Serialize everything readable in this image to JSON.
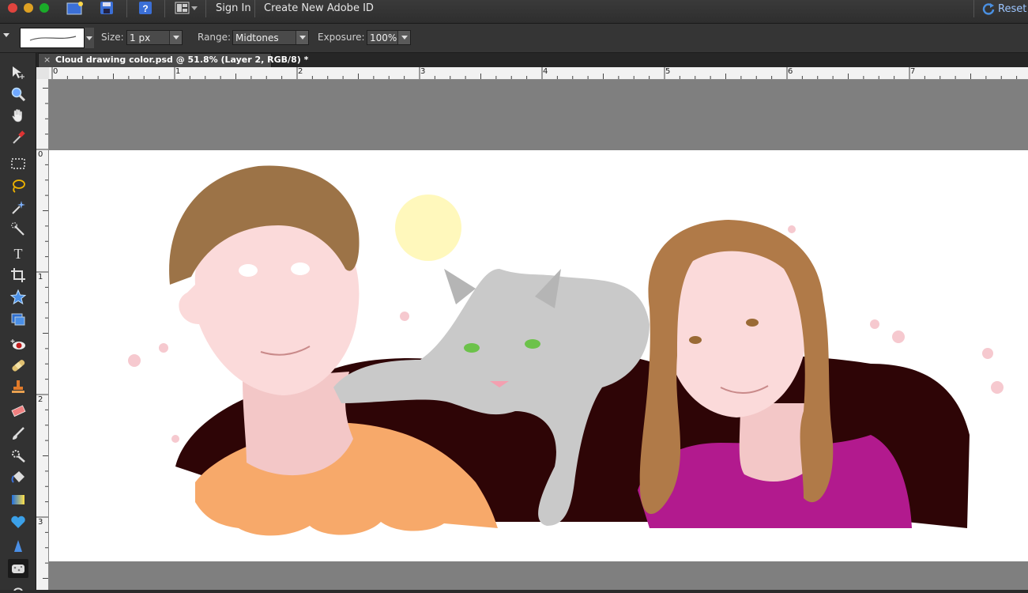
{
  "menubar": {
    "sign_in": "Sign In",
    "create_id": "Create New Adobe ID",
    "reset": "Reset"
  },
  "options": {
    "size_label": "Size:",
    "size_value": "1 px",
    "range_label": "Range:",
    "range_value": "Midtones",
    "exposure_label": "Exposure:",
    "exposure_value": "100%"
  },
  "document": {
    "tab_title": "Cloud drawing color.psd @ 51.8% (Layer 2, RGB/8) *",
    "close": "×"
  },
  "rulers": {
    "top": [
      "0",
      "1",
      "2",
      "3",
      "4",
      "5",
      "6",
      "7"
    ],
    "left": [
      "0",
      "1",
      "2",
      "3"
    ]
  },
  "tools": [
    "move-icon",
    "zoom-icon",
    "hand-icon",
    "eyedropper-icon",
    "marquee-icon",
    "lasso-icon",
    "magic-wand-icon",
    "quick-selection-icon",
    "type-icon",
    "crop-icon",
    "custom-shape-icon",
    "recompose-icon",
    "red-eye-icon",
    "healing-brush-icon",
    "clone-stamp-icon",
    "eraser-icon",
    "brush-icon",
    "smart-brush-icon",
    "paint-bucket-icon",
    "gradient-icon",
    "shape-icon",
    "blur-icon",
    "sponge-icon"
  ],
  "colors": {
    "accent": "#9cc5ff",
    "shirt_left": "#f7a96a",
    "shirt_right": "#b21a8e",
    "background_dark": "#2e0506",
    "hair_boy": "#9c7347",
    "hair_girl": "#b07a48"
  }
}
